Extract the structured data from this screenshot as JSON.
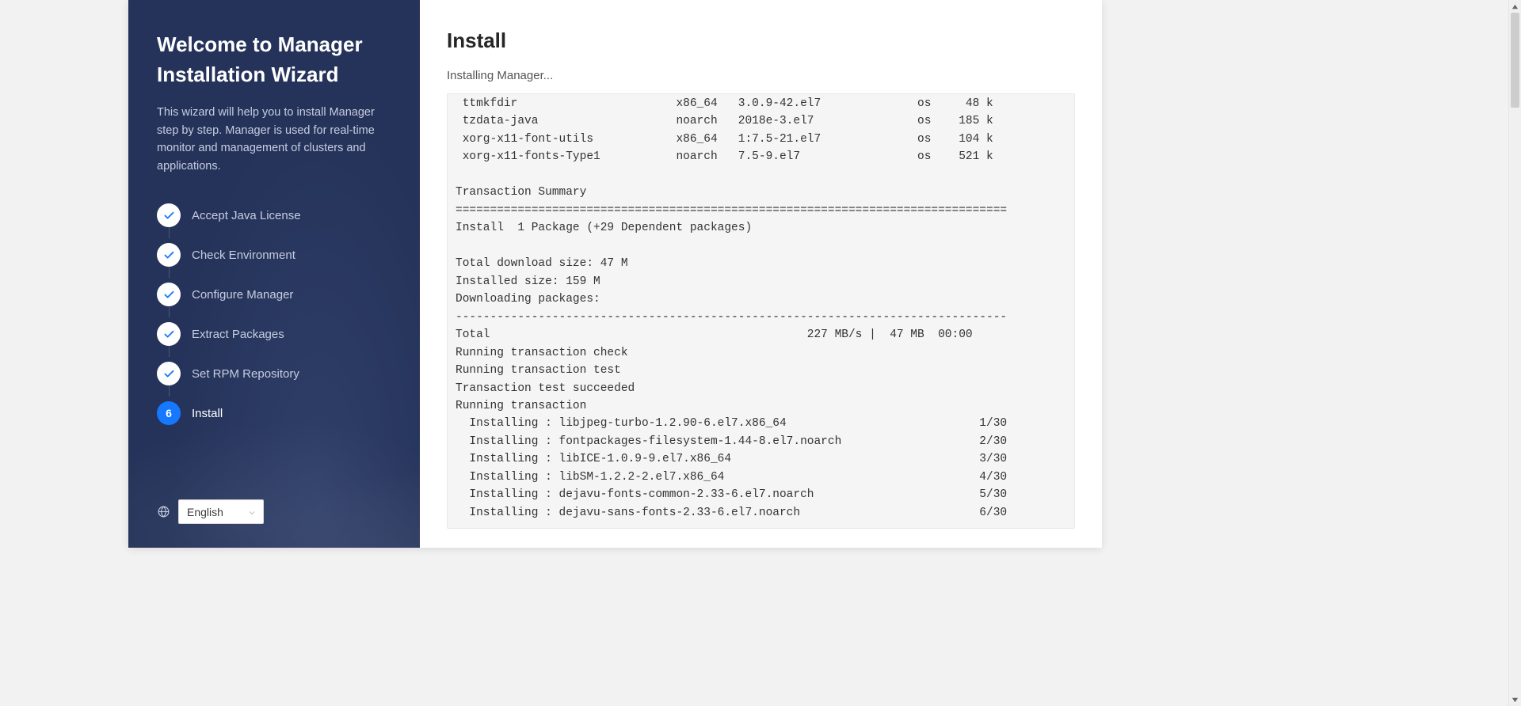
{
  "sidebar": {
    "title": "Welcome to Manager Installation Wizard",
    "description": "This wizard will help you to install Manager step by step. Manager is used for real-time monitor and management of clusters and applications.",
    "steps": [
      {
        "label": "Accept Java License",
        "state": "done"
      },
      {
        "label": "Check Environment",
        "state": "done"
      },
      {
        "label": "Configure Manager",
        "state": "done"
      },
      {
        "label": "Extract Packages",
        "state": "done"
      },
      {
        "label": "Set RPM Repository",
        "state": "done"
      },
      {
        "label": "Install",
        "state": "current",
        "number": "6"
      }
    ],
    "language": {
      "selected": "English"
    }
  },
  "main": {
    "title": "Install",
    "subtitle": "Installing Manager...",
    "terminal": " ttmkfdir                       x86_64   3.0.9-42.el7              os     48 k\n tzdata-java                    noarch   2018e-3.el7               os    185 k\n xorg-x11-font-utils            x86_64   1:7.5-21.el7              os    104 k\n xorg-x11-fonts-Type1           noarch   7.5-9.el7                 os    521 k\n\nTransaction Summary\n================================================================================\nInstall  1 Package (+29 Dependent packages)\n\nTotal download size: 47 M\nInstalled size: 159 M\nDownloading packages:\n--------------------------------------------------------------------------------\nTotal                                              227 MB/s |  47 MB  00:00\nRunning transaction check\nRunning transaction test\nTransaction test succeeded\nRunning transaction\n  Installing : libjpeg-turbo-1.2.90-6.el7.x86_64                            1/30\n  Installing : fontpackages-filesystem-1.44-8.el7.noarch                    2/30\n  Installing : libICE-1.0.9-9.el7.x86_64                                    3/30\n  Installing : libSM-1.2.2-2.el7.x86_64                                     4/30\n  Installing : dejavu-fonts-common-2.33-6.el7.noarch                        5/30\n  Installing : dejavu-sans-fonts-2.33-6.el7.noarch                          6/30"
  },
  "colors": {
    "sidebar_bg": "#25335a",
    "accent": "#1677ff"
  }
}
